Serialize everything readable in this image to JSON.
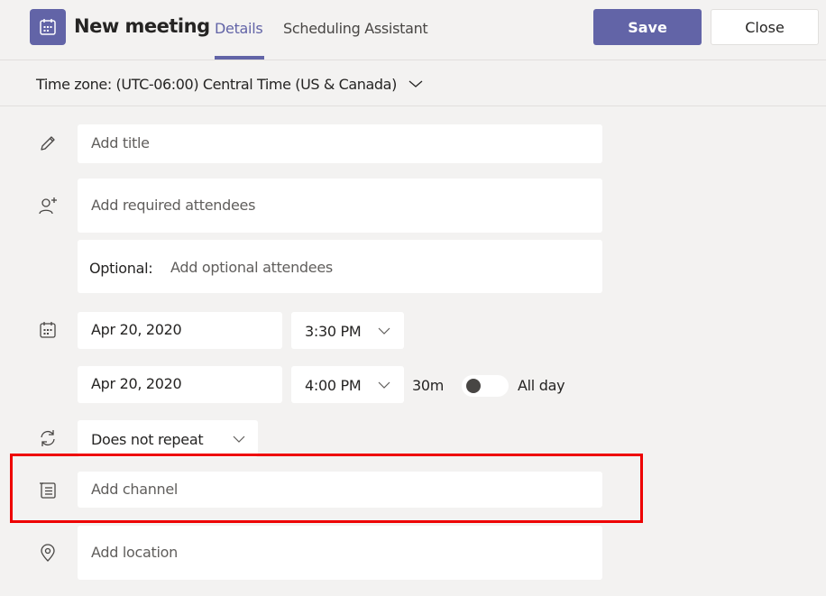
{
  "header": {
    "app_icon": "calendar-icon",
    "title": "New meeting",
    "tabs": [
      {
        "label": "Details",
        "active": true
      },
      {
        "label": "Scheduling Assistant",
        "active": false
      }
    ],
    "save_label": "Save",
    "close_label": "Close"
  },
  "timezone": {
    "label": "Time zone: (UTC-06:00) Central Time (US & Canada)"
  },
  "form": {
    "title_placeholder": "Add title",
    "attendees_placeholder": "Add required attendees",
    "optional_label": "Optional:",
    "optional_placeholder": "Add optional attendees",
    "start_date": "Apr 20, 2020",
    "start_time": "3:30 PM",
    "end_date": "Apr 20, 2020",
    "end_time": "4:00 PM",
    "duration": "30m",
    "all_day_label": "All day",
    "all_day_on": false,
    "repeat": "Does not repeat",
    "channel_placeholder": "Add channel",
    "location_placeholder": "Add location"
  },
  "colors": {
    "accent": "#6264a7",
    "highlight": "#ee0000",
    "background": "#f3f2f1"
  }
}
